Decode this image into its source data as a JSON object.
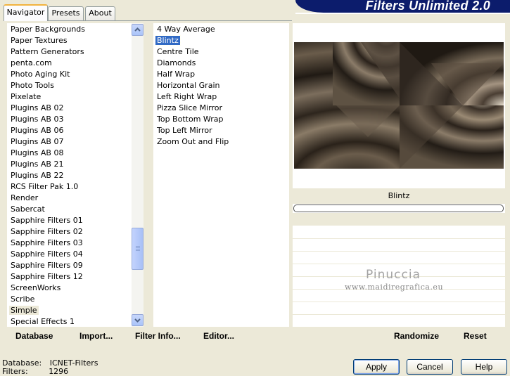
{
  "tabs": [
    {
      "label": "Navigator",
      "active": true
    },
    {
      "label": "Presets",
      "active": false
    },
    {
      "label": "About",
      "active": false
    }
  ],
  "logo": {
    "title": "Filters Unlimited 2.0"
  },
  "categories": [
    {
      "label": "Paper Backgrounds"
    },
    {
      "label": "Paper Textures"
    },
    {
      "label": "Pattern Generators"
    },
    {
      "label": "penta.com"
    },
    {
      "label": "Photo Aging Kit"
    },
    {
      "label": "Photo Tools"
    },
    {
      "label": "Pixelate"
    },
    {
      "label": "Plugins AB 02"
    },
    {
      "label": "Plugins AB 03"
    },
    {
      "label": "Plugins AB 06"
    },
    {
      "label": "Plugins AB 07"
    },
    {
      "label": "Plugins AB 08"
    },
    {
      "label": "Plugins AB 21"
    },
    {
      "label": "Plugins AB 22"
    },
    {
      "label": "RCS Filter Pak 1.0"
    },
    {
      "label": "Render"
    },
    {
      "label": "Sabercat"
    },
    {
      "label": "Sapphire Filters 01"
    },
    {
      "label": "Sapphire Filters 02"
    },
    {
      "label": "Sapphire Filters 03"
    },
    {
      "label": "Sapphire Filters 04"
    },
    {
      "label": "Sapphire Filters 09"
    },
    {
      "label": "Sapphire Filters 12"
    },
    {
      "label": "ScreenWorks"
    },
    {
      "label": "Scribe"
    },
    {
      "label": "Simple",
      "highlighted": true
    },
    {
      "label": "Special Effects 1"
    }
  ],
  "filters": [
    {
      "label": "4 Way Average"
    },
    {
      "label": "Blintz",
      "selected": true
    },
    {
      "label": "Centre Tile"
    },
    {
      "label": "Diamonds"
    },
    {
      "label": "Half Wrap"
    },
    {
      "label": "Horizontal Grain"
    },
    {
      "label": "Left Right Wrap"
    },
    {
      "label": "Pizza Slice Mirror"
    },
    {
      "label": "Top Bottom Wrap"
    },
    {
      "label": "Top Left Mirror"
    },
    {
      "label": "Zoom Out and Flip"
    }
  ],
  "left_toolbar": {
    "database": "Database",
    "import": "Import...",
    "filter_info": "Filter Info...",
    "editor": "Editor..."
  },
  "right_toolbar": {
    "randomize": "Randomize",
    "reset": "Reset"
  },
  "parameter": {
    "label": "Blintz"
  },
  "watermark": {
    "line1": "Pinuccia",
    "line2": "www.maidiregrafica.eu"
  },
  "status": {
    "database_label": "Database:",
    "database_value": "ICNET-Filters",
    "filters_label": "Filters:",
    "filters_value": "1296"
  },
  "buttons": {
    "apply": "Apply",
    "cancel": "Cancel",
    "help": "Help"
  },
  "icons": {
    "scroll_up": "arrow-up-icon",
    "scroll_down": "arrow-down-icon"
  },
  "colors": {
    "selection": "#316ac5",
    "logo_bg": "#0c1c6c",
    "window_bg": "#ece9d8"
  }
}
